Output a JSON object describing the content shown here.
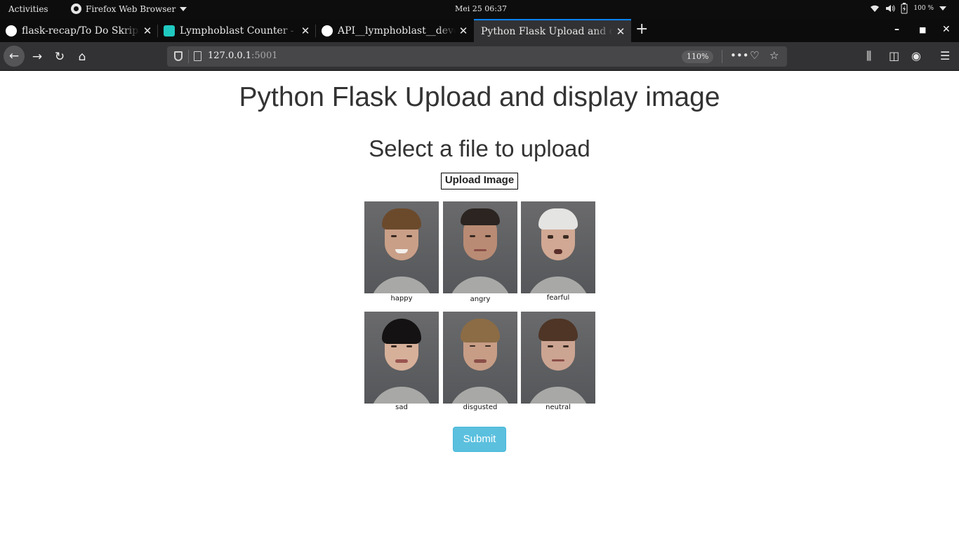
{
  "system_bar": {
    "activities": "Activities",
    "app_name": "Firefox Web Browser",
    "clock": "Mei 25  06:37",
    "battery": "100 %"
  },
  "tabs": [
    {
      "title": "flask-recap/To Do Skripsi",
      "favicon": "github-icon"
    },
    {
      "title": "Lymphoblast Counter - ",
      "favicon": "chart-icon"
    },
    {
      "title": "API__lymphoblast__deve",
      "favicon": "github-icon"
    },
    {
      "title": "Python Flask Upload and di",
      "favicon": "none",
      "active": true
    }
  ],
  "urlbar": {
    "host": "127.0.0.1",
    "port": ":5001",
    "zoom": "110%"
  },
  "page": {
    "title": "Python Flask Upload and display image",
    "subtitle": "Select a file to upload",
    "upload_label": "Upload Image",
    "submit_label": "Submit",
    "images": [
      {
        "caption": "happy"
      },
      {
        "caption": "angry"
      },
      {
        "caption": "fearful"
      },
      {
        "caption": "sad"
      },
      {
        "caption": "disgusted"
      },
      {
        "caption": "neutral"
      }
    ]
  }
}
